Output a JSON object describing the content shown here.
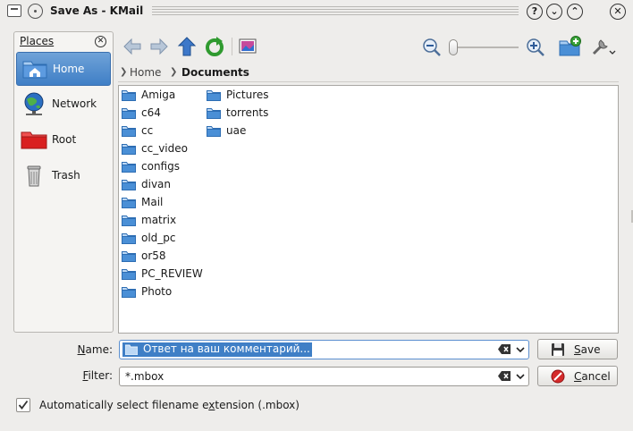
{
  "window": {
    "title": "Save As - KMail"
  },
  "places": {
    "title": "Places",
    "items": [
      {
        "label": "Home",
        "icon": "home-folder-icon",
        "active": true
      },
      {
        "label": "Network",
        "icon": "network-globe-icon",
        "active": false
      },
      {
        "label": "Root",
        "icon": "root-folder-icon",
        "active": false
      },
      {
        "label": "Trash",
        "icon": "trash-icon",
        "active": false
      }
    ]
  },
  "breadcrumb": {
    "items": [
      {
        "label": "Home"
      },
      {
        "label": "Documents"
      }
    ]
  },
  "files": {
    "column1": [
      "Amiga",
      "c64",
      "cc",
      "cc_video",
      "configs",
      "divan",
      "Mail",
      "matrix",
      "old_pc",
      "or58",
      "PC_REVIEW",
      "Photo"
    ],
    "column2": [
      "Pictures",
      "torrents",
      "uae"
    ]
  },
  "form": {
    "name_label_u": "N",
    "name_label_rest": "ame:",
    "name_value": "Ответ на ваш комментарий...",
    "filter_label_u": "F",
    "filter_label_rest": "ilter:",
    "filter_value": "*.mbox",
    "save_u": "S",
    "save_rest": "ave",
    "cancel_u": "C",
    "cancel_rest": "ancel",
    "checkbox_pre": "Automatically select filename e",
    "checkbox_u": "x",
    "checkbox_post": "tension (.mbox)",
    "checkbox_checked": true
  },
  "colors": {
    "selection": "#3f7fc6",
    "folder": "#4a8fd6"
  }
}
